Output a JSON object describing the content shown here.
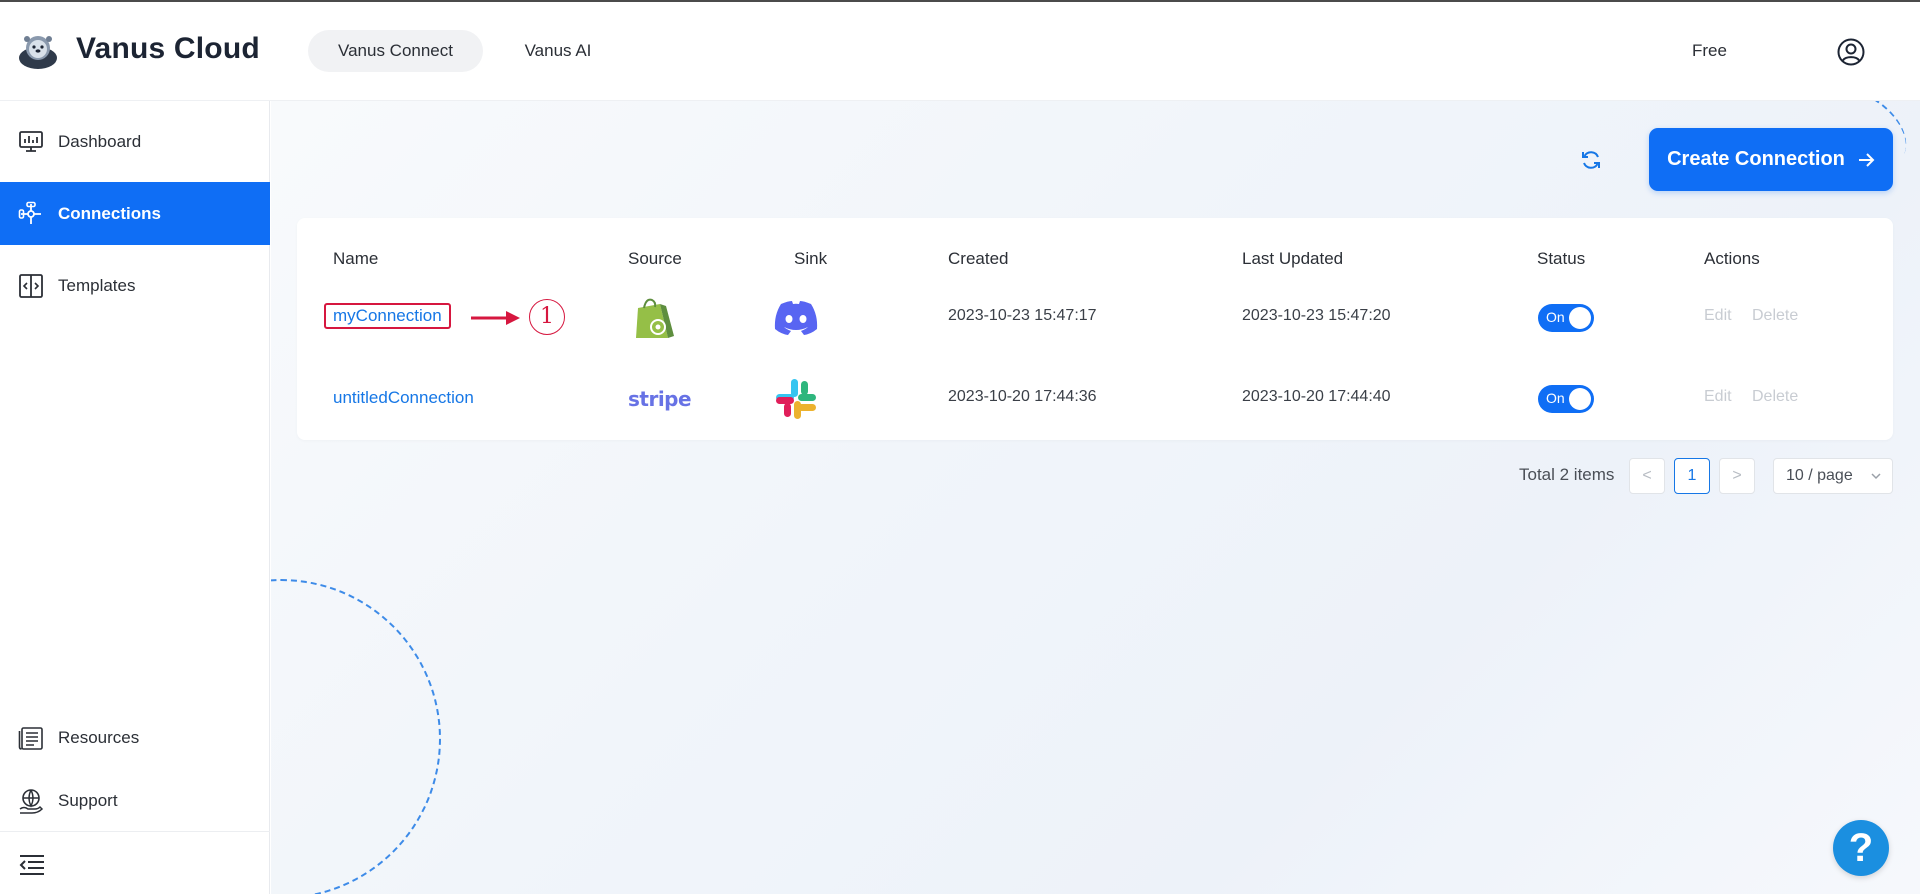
{
  "app": {
    "brand": "Vanus Cloud"
  },
  "header": {
    "tabs": [
      {
        "label": "Vanus Connect",
        "active": true
      },
      {
        "label": "Vanus AI",
        "active": false
      }
    ],
    "plan": "Free"
  },
  "sidebar": {
    "items": [
      {
        "label": "Dashboard",
        "icon": "monitor-icon"
      },
      {
        "label": "Connections",
        "icon": "connections-icon",
        "active": true
      },
      {
        "label": "Templates",
        "icon": "templates-icon"
      }
    ],
    "bottom_items": [
      {
        "label": "Resources",
        "icon": "resources-icon"
      },
      {
        "label": "Support",
        "icon": "globe-hand-icon"
      }
    ]
  },
  "toolbar": {
    "create_label": "Create Connection"
  },
  "table": {
    "headers": [
      "Name",
      "Source",
      "Sink",
      "Created",
      "Last Updated",
      "Status",
      "Actions"
    ],
    "rows": [
      {
        "name": "myConnection",
        "source": "shopify-icon",
        "sink": "discord-icon",
        "created": "2023-10-23 15:47:17",
        "updated": "2023-10-23 15:47:20",
        "status": "On",
        "edit": "Edit",
        "delete": "Delete"
      },
      {
        "name": "untitledConnection",
        "source": "stripe",
        "sink": "slack-icon",
        "created": "2023-10-20 17:44:36",
        "updated": "2023-10-20 17:44:40",
        "status": "On",
        "edit": "Edit",
        "delete": "Delete"
      }
    ]
  },
  "annotation": {
    "number": "1",
    "color": "#d6173f"
  },
  "pagination": {
    "total": "Total 2 items",
    "prev": "<",
    "current": "1",
    "next": ">",
    "page_size": "10 / page"
  },
  "help": {
    "label": "?"
  },
  "colors": {
    "primary": "#0f6ef5",
    "link": "#1677e6",
    "annotation": "#d6173f"
  }
}
